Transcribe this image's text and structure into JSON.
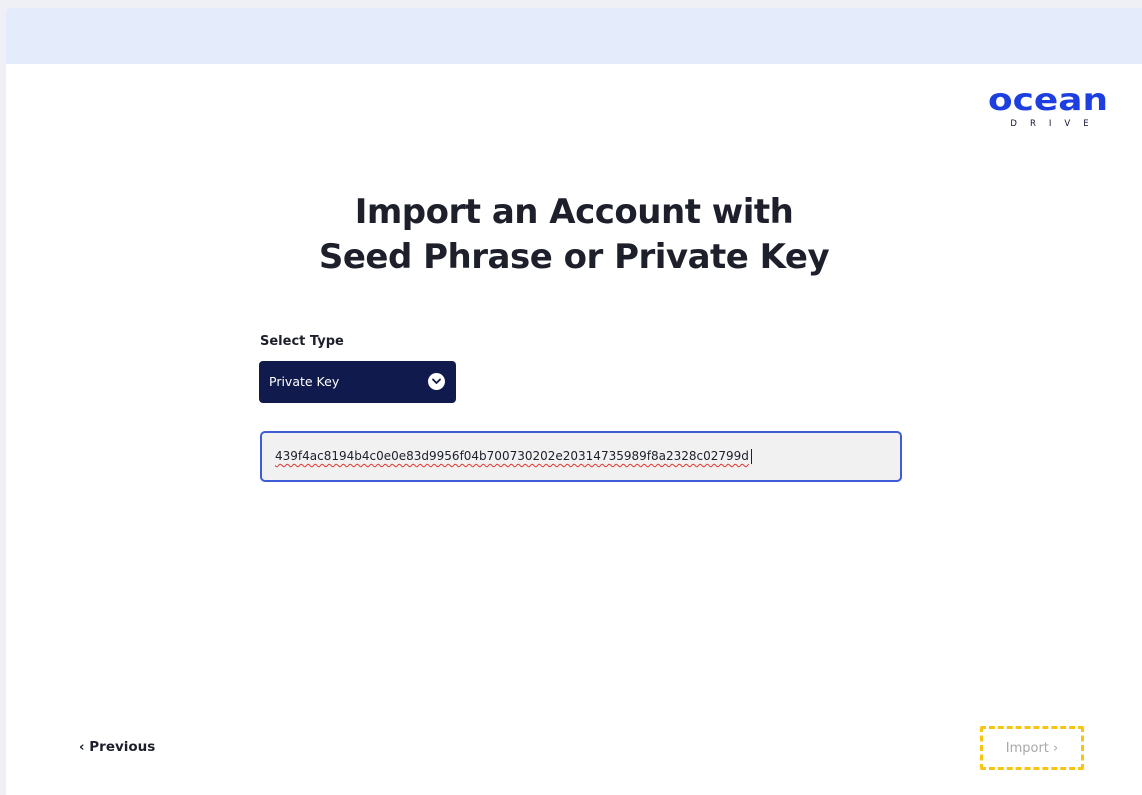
{
  "brand": {
    "name": "ocean",
    "tagline": "DRIVE",
    "color": "#1d3fe0"
  },
  "page": {
    "heading_line1": "Import an Account with",
    "heading_line2": "Seed Phrase or Private Key"
  },
  "form": {
    "select_label": "Select Type",
    "selected_type": "Private Key",
    "dropdown_icon": "chevron-down-icon",
    "key_value": "439f4ac8194b4c0e0e83d9956f04b700730202e20314735989f8a2328c02799d"
  },
  "nav": {
    "previous_label": "‹ Previous",
    "import_label": "Import ›"
  },
  "colors": {
    "banner": "#e4ebfb",
    "dropdown_bg": "#101a4c",
    "field_border": "#3e5bd8",
    "import_highlight": "#f6c512"
  }
}
